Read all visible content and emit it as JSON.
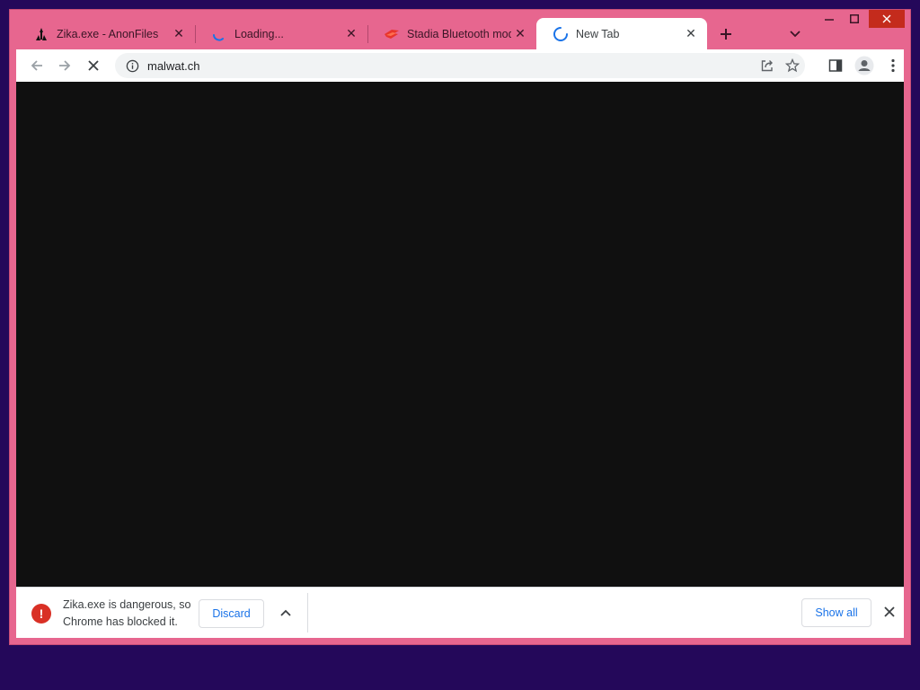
{
  "tabs": [
    {
      "title": "Zika.exe - AnonFiles",
      "icon": "anonfiles-icon",
      "active": false
    },
    {
      "title": "Loading...",
      "icon": "loading-spinner-icon",
      "active": false
    },
    {
      "title": "Stadia Bluetooth mode",
      "icon": "stadia-icon",
      "active": false
    },
    {
      "title": "New Tab",
      "icon": "loading-spinner-icon",
      "active": true
    }
  ],
  "toolbar": {
    "url": "malwat.ch"
  },
  "download": {
    "message": "Zika.exe is dangerous, so Chrome has blocked it.",
    "discard_label": "Discard",
    "show_all_label": "Show all"
  },
  "colors": {
    "frame": "#e7668f",
    "desktop": "#24085a",
    "content": "#101010",
    "accent": "#1a73e8",
    "danger": "#d93025"
  }
}
